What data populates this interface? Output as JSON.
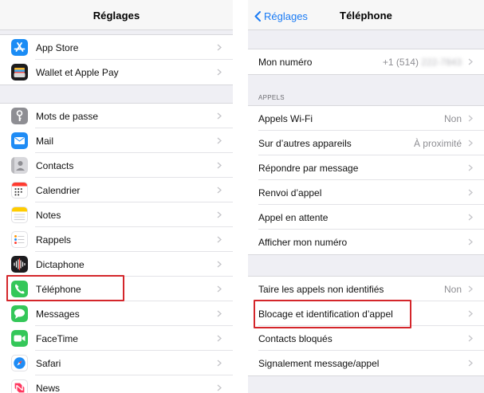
{
  "left": {
    "title": "Réglages",
    "group1": [
      {
        "label": "App Store",
        "icon": "app-store-icon"
      },
      {
        "label": "Wallet et Apple Pay",
        "icon": "wallet-icon"
      }
    ],
    "group2": [
      {
        "label": "Mots de passe",
        "icon": "key-icon"
      },
      {
        "label": "Mail",
        "icon": "mail-icon"
      },
      {
        "label": "Contacts",
        "icon": "contacts-icon"
      },
      {
        "label": "Calendrier",
        "icon": "calendar-icon"
      },
      {
        "label": "Notes",
        "icon": "notes-icon"
      },
      {
        "label": "Rappels",
        "icon": "reminders-icon"
      },
      {
        "label": "Dictaphone",
        "icon": "voice-memos-icon"
      },
      {
        "label": "Téléphone",
        "icon": "phone-icon"
      },
      {
        "label": "Messages",
        "icon": "messages-icon"
      },
      {
        "label": "FaceTime",
        "icon": "facetime-icon"
      },
      {
        "label": "Safari",
        "icon": "safari-icon"
      },
      {
        "label": "News",
        "icon": "news-icon"
      }
    ]
  },
  "right": {
    "back_label": "Réglages",
    "title": "Téléphone",
    "my_number": {
      "label": "Mon numéro",
      "value_visible": "+1 (514)",
      "value_blurred": "222-7843"
    },
    "section_calls": "APPELS",
    "calls": [
      {
        "label": "Appels Wi-Fi",
        "value": "Non"
      },
      {
        "label": "Sur d’autres appareils",
        "value": "À proximité"
      },
      {
        "label": "Répondre par message",
        "value": ""
      },
      {
        "label": "Renvoi d’appel",
        "value": ""
      },
      {
        "label": "Appel en attente",
        "value": ""
      },
      {
        "label": "Afficher mon numéro",
        "value": ""
      }
    ],
    "blocking": [
      {
        "label": "Taire les appels non identifiés",
        "value": "Non"
      },
      {
        "label": "Blocage et identification d’appel",
        "value": ""
      },
      {
        "label": "Contacts bloqués",
        "value": ""
      },
      {
        "label": "Signalement message/appel",
        "value": ""
      }
    ]
  },
  "colors": {
    "highlight": "#d4262b",
    "link": "#1a7bf5",
    "group_background": "#efeff4"
  }
}
